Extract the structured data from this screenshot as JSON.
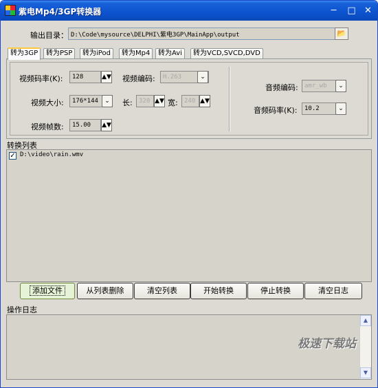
{
  "window": {
    "title": "紫电Mp4/3GP转换器",
    "buttons": {
      "minimize": "─",
      "maximize": "□",
      "close": "✕"
    }
  },
  "output": {
    "label": "输出目录：",
    "path": "D:\\Code\\mysource\\DELPHI\\紫电3GP\\MainApp\\output",
    "browse_icon": "📂"
  },
  "tabs": [
    "转为3GP",
    "转为PSP",
    "转为iPod",
    "转为Mp4",
    "转为Avi",
    "转为VCD,SVCD,DVD"
  ],
  "video": {
    "bitrate_label": "视频码率(K):",
    "bitrate": "128",
    "codec_label": "视频编码:",
    "codec": "H.263",
    "size_label": "视频大小:",
    "size": "176*144",
    "length_label": "长:",
    "length": "320",
    "width_label": "宽:",
    "width": "240",
    "fps_label": "视频帧数:",
    "fps": "15.00"
  },
  "audio": {
    "codec_label": "音频编码:",
    "codec": "amr_wb",
    "bitrate_label": "音频码率(K):",
    "bitrate": "10.2"
  },
  "convert_list": {
    "title": "转换列表",
    "items": [
      {
        "checked": "✓",
        "path": "D:\\video\\rain.wmv"
      }
    ]
  },
  "actions": {
    "add_file": "添加文件",
    "remove": "从列表删除",
    "clear_list": "清空列表",
    "start": "开始转换",
    "stop": "停止转换",
    "clear_log": "清空日志"
  },
  "log": {
    "title": "操作日志"
  },
  "watermark": "极速下载站",
  "glyphs": {
    "spin": "▲▼",
    "dropdown": "⌄",
    "scroll_up": "▲",
    "scroll_down": "▼"
  }
}
